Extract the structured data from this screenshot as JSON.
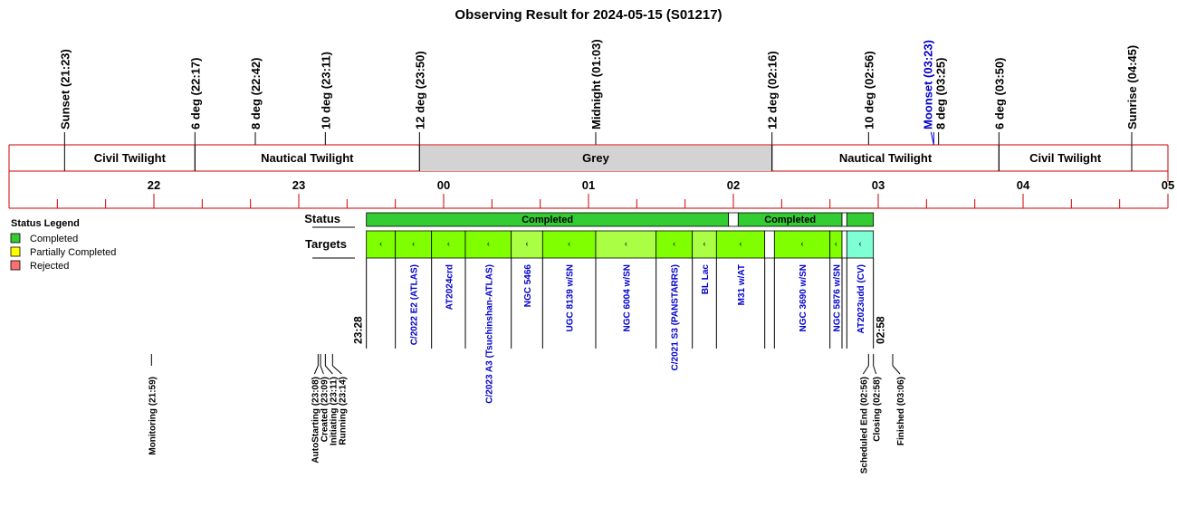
{
  "title": "Observing Result for 2024-05-15 (S01217)",
  "colors": {
    "axis_red": "#cc0000",
    "grey_band": "#d3d3d3",
    "completed": "#33cc33",
    "partially_completed": "#ffff00",
    "rejected": "#ff7070",
    "target_green": "#80ff00",
    "target_lightgreen": "#aaff44",
    "target_cyan": "#7fffd4",
    "blue_label": "#0000cc"
  },
  "events": [
    {
      "label": "Sunset (21:23)",
      "time": "21:23",
      "blue": false
    },
    {
      "label": "6 deg (22:17)",
      "time": "22:17",
      "blue": false
    },
    {
      "label": "8 deg (22:42)",
      "time": "22:42",
      "blue": false
    },
    {
      "label": "10 deg (23:11)",
      "time": "23:11",
      "blue": false
    },
    {
      "label": "12 deg (23:50)",
      "time": "23:50",
      "blue": false
    },
    {
      "label": "Midnight (01:03)",
      "time": "01:03",
      "blue": false
    },
    {
      "label": "12 deg (02:16)",
      "time": "02:16",
      "blue": false
    },
    {
      "label": "10 deg (02:56)",
      "time": "02:56",
      "blue": false
    },
    {
      "label": "Moonset (03:23)",
      "time": "03:23",
      "blue": true
    },
    {
      "label": "8 deg (03:25)",
      "time": "03:25",
      "blue": false
    },
    {
      "label": "6 deg (03:50)",
      "time": "03:50",
      "blue": false
    },
    {
      "label": "Sunrise (04:45)",
      "time": "04:45",
      "blue": false
    }
  ],
  "twilight_bands": [
    {
      "label": "Civil Twilight",
      "start": "21:23",
      "end": "22:17",
      "grey": false
    },
    {
      "label": "Nautical Twilight",
      "start": "22:17",
      "end": "23:50",
      "grey": false
    },
    {
      "label": "Grey",
      "start": "23:50",
      "end": "02:16",
      "grey": true
    },
    {
      "label": "Nautical Twilight",
      "start": "02:16",
      "end": "03:50",
      "grey": false
    },
    {
      "label": "Civil Twilight",
      "start": "03:50",
      "end": "04:45",
      "grey": false
    }
  ],
  "hour_ticks": [
    "22",
    "23",
    "00",
    "01",
    "02",
    "03",
    "04",
    "05"
  ],
  "row_labels": {
    "status": "Status",
    "targets": "Targets"
  },
  "status_blocks": [
    {
      "label": "Completed",
      "start": "23:28",
      "end": "01:58"
    },
    {
      "label": "",
      "start": "01:58",
      "end": "02:02"
    },
    {
      "label": "Completed",
      "start": "02:02",
      "end": "02:45"
    },
    {
      "label": "",
      "start": "02:45",
      "end": "02:47"
    },
    {
      "label": "",
      "start": "02:47",
      "end": "02:58"
    }
  ],
  "targets": [
    {
      "name": "",
      "start": "23:28",
      "end": "23:40",
      "tone": "green"
    },
    {
      "name": "C/2022 E2 (ATLAS)",
      "start": "23:40",
      "end": "23:55",
      "tone": "green"
    },
    {
      "name": "AT2024crd",
      "start": "23:55",
      "end": "00:09",
      "tone": "green"
    },
    {
      "name": "C/2023 A3 (Tsuchinshan-ATLAS)",
      "start": "00:09",
      "end": "00:28",
      "tone": "green"
    },
    {
      "name": "NGC 5466",
      "start": "00:28",
      "end": "00:41",
      "tone": "lightgreen"
    },
    {
      "name": "UGC 8139 w/SN",
      "start": "00:41",
      "end": "01:03",
      "tone": "green"
    },
    {
      "name": "NGC 6004 w/SN",
      "start": "01:03",
      "end": "01:28",
      "tone": "lightgreen"
    },
    {
      "name": "C/2021 S3 (PANSTARRS)",
      "start": "01:28",
      "end": "01:43",
      "tone": "green"
    },
    {
      "name": "BL Lac",
      "start": "01:43",
      "end": "01:53",
      "tone": "lightgreen"
    },
    {
      "name": "M31 w/AT",
      "start": "01:53",
      "end": "02:13",
      "tone": "green"
    },
    {
      "name": "",
      "start": "02:13",
      "end": "02:17",
      "tone": "white"
    },
    {
      "name": "NGC 3690 w/SN",
      "start": "02:17",
      "end": "02:40",
      "tone": "green"
    },
    {
      "name": "NGC 5876 w/SN",
      "start": "02:40",
      "end": "02:45",
      "tone": "green"
    },
    {
      "name": "",
      "start": "02:45",
      "end": "02:47",
      "tone": "white"
    },
    {
      "name": "AT2023udd (CV)",
      "start": "02:47",
      "end": "02:58",
      "tone": "cyan"
    }
  ],
  "start_time_label": "23:28",
  "end_time_label": "02:58",
  "state_events": [
    {
      "label": "Monitoring (21:59)",
      "time": "21:59"
    },
    {
      "label": "AutoStarting (23:08)",
      "time": "23:08"
    },
    {
      "label": "Created (23:09)",
      "time": "23:09"
    },
    {
      "label": "Initiating (23:11)",
      "time": "23:11"
    },
    {
      "label": "Running (23:14)",
      "time": "23:14"
    },
    {
      "label": "Scheduled End (02:56)",
      "time": "02:56"
    },
    {
      "label": "Closing (02:58)",
      "time": "02:58"
    },
    {
      "label": "Finished (03:06)",
      "time": "03:06"
    }
  ],
  "legend": {
    "title": "Status Legend",
    "items": [
      {
        "label": "Completed",
        "color": "#33cc33"
      },
      {
        "label": "Partially Completed",
        "color": "#ffff00"
      },
      {
        "label": "Rejected",
        "color": "#ff7070"
      }
    ]
  },
  "chart_data": {
    "type": "table",
    "title": "Observing Result for 2024-05-15 (S01217)",
    "x_axis": {
      "type": "time",
      "range": [
        "21:00",
        "05:00"
      ],
      "tick_labels": [
        "22",
        "23",
        "00",
        "01",
        "02",
        "03",
        "04",
        "05"
      ]
    }
  }
}
